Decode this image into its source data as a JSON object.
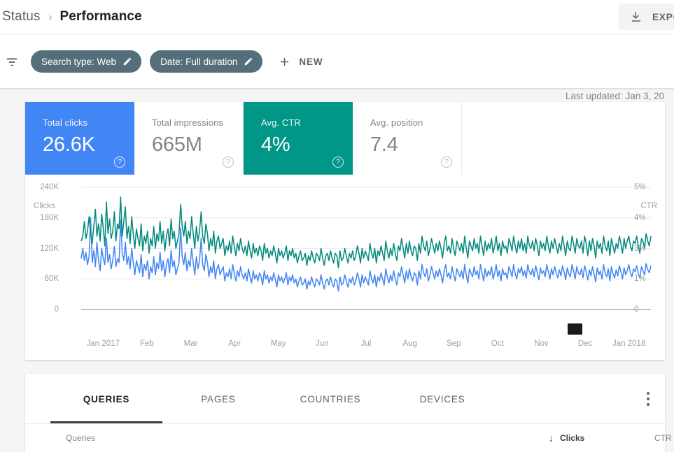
{
  "header": {
    "breadcrumb_root": "Status",
    "breadcrumb_separator": "›",
    "breadcrumb_current": "Performance",
    "export_label": "EXPORT",
    "export_icon": "download-icon"
  },
  "toolbar": {
    "filter_icon": "filter-icon",
    "chips": [
      {
        "label": "Search type: Web",
        "edit_icon": "pencil-icon"
      },
      {
        "label": "Date: Full duration",
        "edit_icon": "pencil-icon"
      }
    ],
    "new_label": "NEW",
    "new_icon": "plus-icon",
    "last_updated": "Last updated: Jan 3, 20"
  },
  "metrics": [
    {
      "label": "Total clicks",
      "value": "26.6K",
      "selected": true,
      "color": "#4285f4",
      "help_icon": "help-icon"
    },
    {
      "label": "Total impressions",
      "value": "665M",
      "selected": false,
      "help_icon": "help-icon"
    },
    {
      "label": "Avg. CTR",
      "value": "4%",
      "selected": true,
      "color": "#009688",
      "help_icon": "help-icon"
    },
    {
      "label": "Avg. position",
      "value": "7.4",
      "selected": false,
      "help_icon": "help-icon"
    }
  ],
  "chart_data": {
    "type": "line",
    "title": "",
    "xlabel": "",
    "ylabel": "Clicks",
    "y2label": "CTR",
    "grid": true,
    "legend": "none",
    "x_tick_labels": [
      "Jan 2017",
      "Feb",
      "Mar",
      "Apr",
      "May",
      "Jun",
      "Jul",
      "Aug",
      "Sep",
      "Oct",
      "Nov",
      "Dec",
      "Jan 2018"
    ],
    "y_left_ticks": [
      "0",
      "60K",
      "120K",
      "180K",
      "240K"
    ],
    "y_left_values": [
      0,
      60000,
      120000,
      180000,
      240000
    ],
    "ylim": [
      0,
      240000
    ],
    "y_right_ticks": [
      "0",
      "1%",
      "3%",
      "4%",
      "5%"
    ],
    "y_right_values": [
      0,
      1,
      3,
      4,
      5
    ],
    "y2lim": [
      0,
      5
    ],
    "series": [
      {
        "name": "Clicks",
        "color": "#4285f4",
        "axis": "left",
        "values": [
          100000,
          120000,
          96000,
          112000,
          88000,
          104000,
          180000,
          92000,
          116000,
          84000,
          132000,
          96000,
          76000,
          120000,
          100000,
          88000,
          140000,
          92000,
          108000,
          80000,
          96000,
          124000,
          84000,
          100000,
          92000,
          176000,
          112000,
          96000,
          132000,
          88000,
          104000,
          80000,
          120000,
          92000,
          68000,
          96000,
          84000,
          72000,
          108000,
          64000,
          88000,
          76000,
          96000,
          60000,
          84000,
          72000,
          104000,
          68000,
          92000,
          80000,
          112000,
          76000,
          96000,
          64000,
          88000,
          100000,
          72000,
          116000,
          84000,
          96000,
          68000,
          80000,
          92000,
          160000,
          104000,
          88000,
          112000,
          76000,
          96000,
          84000,
          120000,
          92000,
          68000,
          104000,
          80000,
          96000,
          140000,
          88000,
          76000,
          108000,
          92000,
          64000,
          84000,
          72000,
          96000,
          60000,
          80000,
          88000,
          68000,
          76000,
          84000,
          56000,
          72000,
          64000,
          80000,
          60000,
          88000,
          72000,
          56000,
          76000,
          64000,
          84000,
          68000,
          60000,
          72000,
          56000,
          80000,
          64000,
          52000,
          76000,
          60000,
          68000,
          56000,
          72000,
          64000,
          48000,
          76000,
          60000,
          68000,
          52000,
          64000,
          56000,
          72000,
          60000,
          44000,
          68000,
          56000,
          64000,
          52000,
          60000,
          72000,
          48000,
          64000,
          56000,
          68000,
          52000,
          60000,
          44000,
          56000,
          64000,
          48000,
          52000,
          60000,
          40000,
          56000,
          48000,
          64000,
          52000,
          44000,
          60000,
          56000,
          48000,
          68000,
          52000,
          40000,
          56000,
          60000,
          48000,
          64000,
          52000,
          44000,
          60000,
          56000,
          36000,
          64000,
          48000,
          52000,
          68000,
          56000,
          44000,
          60000,
          52000,
          64000,
          48000,
          56000,
          72000,
          60000,
          44000,
          68000,
          52000,
          64000,
          56000,
          48000,
          76000,
          60000,
          52000,
          68000,
          44000,
          64000,
          56000,
          72000,
          60000,
          48000,
          80000,
          64000,
          52000,
          68000,
          56000,
          76000,
          60000,
          48000,
          72000,
          64000,
          84000,
          68000,
          52000,
          76000,
          60000,
          80000,
          64000,
          56000,
          72000,
          68000,
          48000,
          76000,
          60000,
          88000,
          72000,
          64000,
          80000,
          56000,
          68000,
          84000,
          72000,
          60000,
          76000,
          64000,
          80000,
          68000,
          52000,
          76000,
          88000,
          64000,
          72000,
          60000,
          84000,
          68000,
          56000,
          80000,
          72000,
          64000,
          76000,
          60000,
          88000,
          68000,
          52000,
          80000,
          72000,
          64000,
          84000,
          68000,
          76000,
          60000,
          88000,
          72000,
          56000,
          80000,
          64000,
          76000,
          68000,
          84000,
          60000,
          72000,
          88000,
          64000,
          76000,
          56000,
          80000,
          68000,
          72000,
          60000,
          84000,
          76000,
          64000,
          88000,
          70000,
          60000,
          80000,
          72000,
          84000,
          66000,
          76000,
          62000,
          88000,
          74000,
          68000,
          80000,
          64000,
          86000,
          72000,
          58000,
          82000,
          70000,
          76000,
          64000,
          88000,
          74000,
          60000,
          80000,
          68000,
          84000,
          72000,
          62000,
          78000,
          66000,
          86000,
          74000,
          58000,
          82000,
          70000,
          64000,
          88000,
          76000,
          60000,
          84000,
          72000,
          68000,
          80000,
          62000,
          86000,
          74000,
          58000,
          78000,
          66000,
          84000,
          70000,
          54000,
          82000,
          68000,
          76000,
          60000,
          88000,
          72000,
          64000,
          80000,
          56000,
          84000,
          70000,
          62000,
          78000,
          66000,
          86000,
          74000,
          60000,
          82000,
          68000,
          76000,
          88000,
          72000,
          64000,
          80000,
          74000,
          86000,
          70000,
          62000,
          84000,
          76000,
          68000,
          90000,
          78000,
          72000,
          86000
        ]
      },
      {
        "name": "CTR",
        "color": "#00897b",
        "axis": "right",
        "values": [
          2.8,
          3.0,
          3.6,
          2.9,
          3.2,
          3.8,
          3.1,
          2.7,
          3.4,
          4.1,
          3.0,
          3.5,
          2.8,
          3.9,
          3.3,
          2.6,
          4.4,
          3.1,
          3.7,
          2.9,
          3.2,
          4.0,
          2.8,
          3.5,
          3.3,
          4.6,
          3.0,
          3.6,
          4.2,
          2.9,
          3.4,
          2.7,
          3.8,
          3.1,
          2.5,
          3.3,
          2.9,
          2.6,
          3.5,
          2.4,
          3.0,
          2.7,
          3.2,
          2.3,
          2.9,
          2.6,
          3.4,
          2.5,
          3.1,
          2.8,
          3.6,
          2.7,
          3.2,
          2.4,
          3.0,
          3.3,
          2.6,
          3.7,
          2.9,
          3.2,
          2.5,
          2.8,
          3.1,
          4.3,
          3.4,
          3.0,
          3.6,
          2.7,
          3.2,
          2.9,
          3.8,
          3.1,
          2.5,
          3.4,
          2.8,
          3.2,
          4.0,
          3.0,
          2.7,
          3.5,
          3.1,
          2.4,
          2.9,
          2.6,
          3.2,
          2.3,
          2.8,
          3.0,
          2.5,
          2.7,
          2.9,
          2.2,
          2.6,
          2.4,
          2.8,
          2.3,
          3.0,
          2.6,
          2.2,
          2.7,
          2.4,
          2.9,
          2.5,
          2.3,
          2.6,
          2.2,
          2.8,
          2.4,
          2.1,
          2.7,
          2.3,
          2.5,
          2.2,
          2.6,
          2.4,
          2.0,
          2.7,
          2.3,
          2.5,
          2.1,
          2.4,
          2.2,
          2.6,
          2.3,
          1.9,
          2.5,
          2.2,
          2.4,
          2.1,
          2.3,
          2.6,
          2.0,
          2.4,
          2.2,
          2.5,
          2.1,
          2.3,
          1.9,
          2.2,
          2.4,
          2.0,
          2.1,
          2.3,
          1.8,
          2.2,
          2.0,
          2.4,
          2.1,
          1.9,
          2.3,
          2.2,
          2.0,
          2.5,
          2.1,
          1.8,
          2.2,
          2.3,
          2.0,
          2.4,
          2.1,
          1.9,
          2.3,
          2.2,
          1.7,
          2.4,
          2.0,
          2.1,
          2.5,
          2.2,
          1.9,
          2.3,
          2.1,
          2.4,
          2.0,
          2.2,
          2.6,
          2.3,
          1.9,
          2.5,
          2.1,
          2.4,
          2.2,
          2.0,
          2.7,
          2.3,
          2.1,
          2.5,
          1.9,
          2.4,
          2.2,
          2.6,
          2.3,
          2.0,
          2.8,
          2.4,
          2.1,
          2.5,
          2.2,
          2.7,
          2.3,
          2.0,
          2.6,
          2.4,
          2.9,
          2.5,
          2.1,
          2.7,
          2.3,
          2.8,
          2.4,
          2.2,
          2.6,
          2.5,
          2.0,
          2.7,
          2.3,
          3.0,
          2.6,
          2.4,
          2.8,
          2.2,
          2.5,
          2.9,
          2.6,
          2.3,
          2.7,
          2.4,
          2.8,
          2.5,
          2.1,
          2.7,
          3.0,
          2.4,
          2.6,
          2.3,
          2.9,
          2.5,
          2.2,
          2.8,
          2.6,
          2.4,
          2.7,
          2.3,
          3.0,
          2.5,
          2.1,
          2.8,
          2.6,
          2.4,
          2.9,
          2.5,
          2.7,
          2.3,
          3.0,
          2.6,
          2.2,
          2.8,
          2.4,
          2.7,
          2.5,
          2.9,
          2.3,
          2.6,
          3.0,
          2.4,
          2.7,
          2.2,
          2.8,
          2.5,
          2.6,
          2.3,
          2.9,
          2.7,
          2.4,
          3.0,
          2.6,
          2.3,
          2.8,
          2.5,
          2.9,
          2.4,
          2.7,
          2.3,
          3.0,
          2.6,
          2.5,
          2.8,
          2.4,
          2.9,
          2.6,
          2.2,
          2.8,
          2.5,
          2.7,
          2.4,
          3.0,
          2.6,
          2.3,
          2.8,
          2.5,
          2.9,
          2.6,
          2.3,
          2.7,
          2.4,
          3.0,
          2.6,
          2.2,
          2.8,
          2.5,
          2.4,
          3.0,
          2.7,
          2.3,
          2.9,
          2.6,
          2.5,
          2.8,
          2.3,
          3.0,
          2.7,
          2.2,
          2.8,
          2.4,
          2.9,
          2.6,
          2.1,
          2.8,
          2.5,
          2.7,
          2.3,
          3.0,
          2.6,
          2.4,
          2.8,
          2.2,
          2.9,
          2.6,
          2.3,
          2.7,
          2.5,
          3.0,
          2.7,
          2.3,
          2.9,
          2.5,
          2.8,
          3.0,
          2.6,
          2.4,
          2.8,
          2.7,
          3.0,
          2.6,
          2.3,
          2.9,
          2.8,
          2.5,
          3.1,
          2.8,
          2.6,
          3.0
        ]
      }
    ]
  },
  "table": {
    "tabs": [
      {
        "label": "QUERIES",
        "active": true
      },
      {
        "label": "PAGES",
        "active": false
      },
      {
        "label": "COUNTRIES",
        "active": false
      },
      {
        "label": "DEVICES",
        "active": false
      }
    ],
    "menu_icon": "kebab-menu-icon",
    "columns": {
      "queries": "Queries",
      "clicks": "Clicks",
      "ctr": "CTR",
      "sort_icon": "↓"
    }
  }
}
